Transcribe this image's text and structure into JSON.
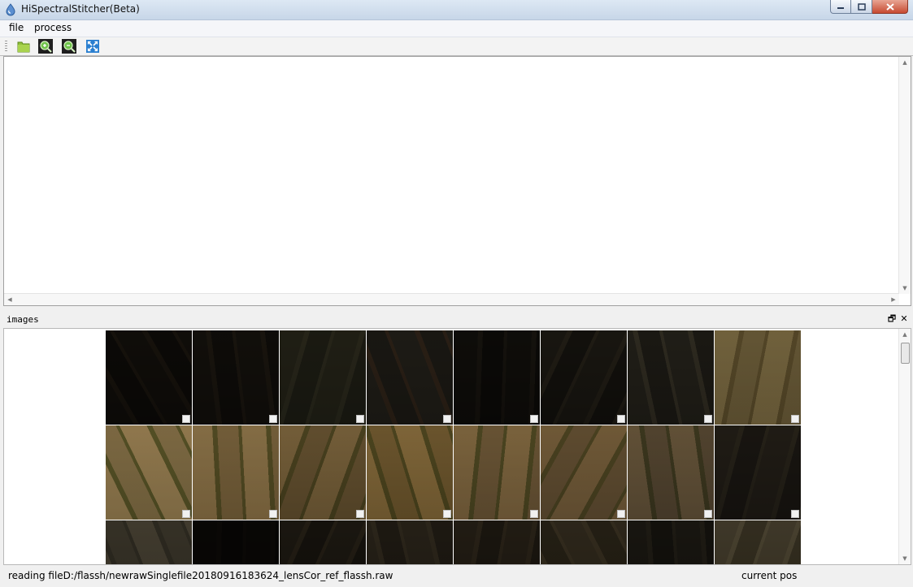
{
  "window": {
    "title": "HiSpectralStitcher(Beta)"
  },
  "menu": {
    "items": [
      "file",
      "process"
    ]
  },
  "toolbar": {
    "icons": [
      "open-folder-icon",
      "zoom-in-icon",
      "zoom-out-icon",
      "fit-to-window-icon"
    ]
  },
  "dock": {
    "title": "images",
    "float_symbol": "🗗",
    "close_symbol": "✕"
  },
  "thumbnails": {
    "count": 24,
    "palette": [
      [
        "#3f3a31",
        "#2f2b25",
        "#5b4f3e"
      ],
      [
        "#433e35",
        "#34302a",
        "#5e5343"
      ],
      [
        "#5a5848",
        "#4a4a3e",
        "#6d6a58"
      ],
      [
        "#56534a",
        "#4a473f",
        "#7a5e48"
      ],
      [
        "#3d3a32",
        "#2e2b26",
        "#585044"
      ],
      [
        "#4f4b41",
        "#3b3831",
        "#686050"
      ],
      [
        "#5a574d",
        "#4a473f",
        "#807a68"
      ],
      [
        "#a99d7c",
        "#958a6c",
        "#7c7050"
      ],
      [
        "#bfae8c",
        "#a59878",
        "#6f7343"
      ],
      [
        "#b7a684",
        "#9e8e6e",
        "#6e6f42"
      ],
      [
        "#ab9a78",
        "#8f8062",
        "#6b6a41"
      ],
      [
        "#b3a078",
        "#978660",
        "#6a6b40"
      ],
      [
        "#b09e7c",
        "#95856a",
        "#6b6e42"
      ],
      [
        "#a89676",
        "#8e7f66",
        "#6e6d44"
      ],
      [
        "#9d8f76",
        "#837764",
        "#5f6040"
      ],
      [
        "#5a5449",
        "#45403a",
        "#6a6553"
      ],
      [
        "#807a6c",
        "#6a665a",
        "#57544a"
      ],
      [
        "#2f2a24",
        "#24201c",
        "#3a342c"
      ],
      [
        "#524c40",
        "#3f3a31",
        "#6a604e"
      ],
      [
        "#615a4c",
        "#4c463c",
        "#726a58"
      ],
      [
        "#5c5446",
        "#474136",
        "#6e6452"
      ],
      [
        "#6a6252",
        "#56503f",
        "#7a705c"
      ],
      [
        "#4e4a40",
        "#3c3931",
        "#615b4d"
      ],
      [
        "#7e7766",
        "#67614f",
        "#918a76"
      ]
    ]
  },
  "status": {
    "message": "reading fileD:/flassh/newrawSinglefile20180916183624_lensCor_ref_flassh.raw",
    "position_label": "current pos"
  }
}
